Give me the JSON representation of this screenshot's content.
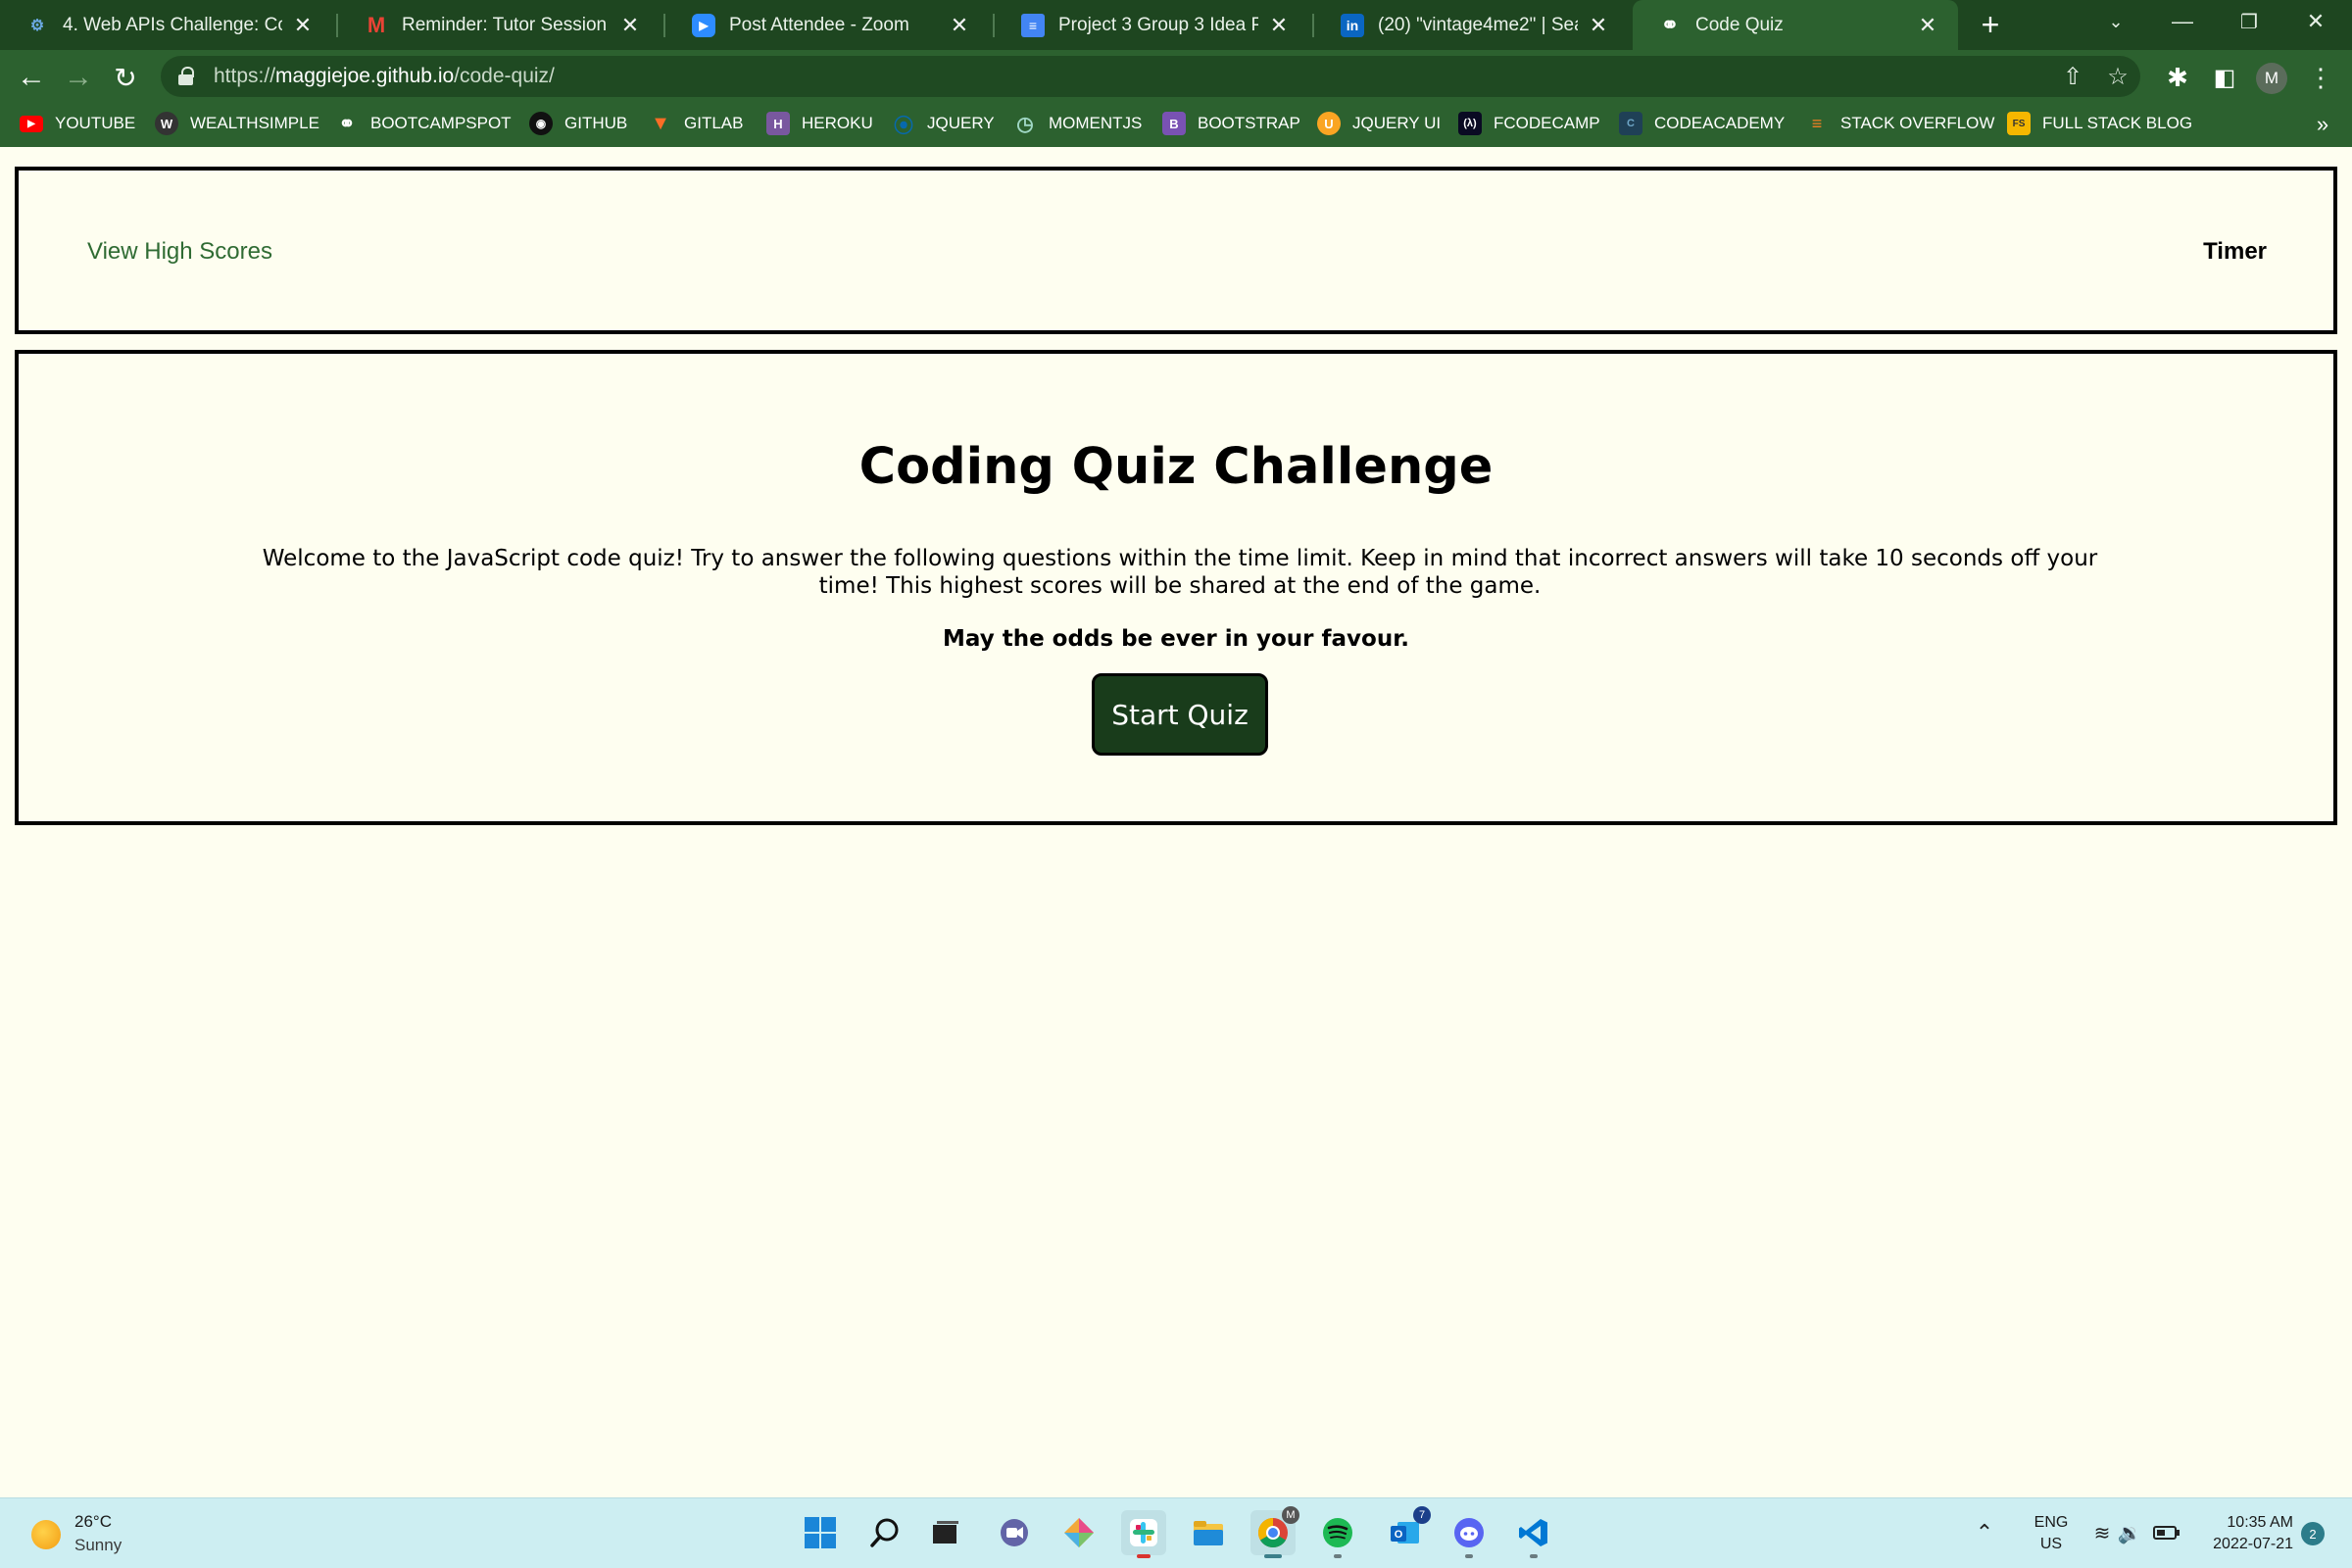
{
  "browser": {
    "tabs": [
      {
        "title": "4. Web APIs Challenge: Code",
        "icon": "bootcamp-icon"
      },
      {
        "title": "Reminder: Tutor Session with",
        "icon": "gmail-icon"
      },
      {
        "title": "Post Attendee - Zoom",
        "icon": "zoom-icon"
      },
      {
        "title": "Project 3 Group 3 Idea Propo",
        "icon": "docs-icon"
      },
      {
        "title": "(20) \"vintage4me2\" | Search |",
        "icon": "linkedin-icon"
      },
      {
        "title": "Code Quiz",
        "icon": "globe-icon",
        "active": true
      }
    ],
    "url_scheme": "https://",
    "url_host": "maggiejoe.github.io",
    "url_path": "/code-quiz/",
    "profile_initial": "M"
  },
  "bookmarks": [
    {
      "label": "YOUTUBE",
      "icon": "youtube-icon"
    },
    {
      "label": "WEALTHSIMPLE",
      "icon": "wealthsimple-icon"
    },
    {
      "label": "BOOTCAMPSPOT",
      "icon": "globe-icon"
    },
    {
      "label": "GITHUB",
      "icon": "github-icon"
    },
    {
      "label": "GITLAB",
      "icon": "gitlab-icon"
    },
    {
      "label": "HEROKU",
      "icon": "heroku-icon"
    },
    {
      "label": "JQUERY",
      "icon": "jquery-icon"
    },
    {
      "label": "MOMENTJS",
      "icon": "momentjs-icon"
    },
    {
      "label": "BOOTSTRAP",
      "icon": "bootstrap-icon"
    },
    {
      "label": "JQUERY UI",
      "icon": "jqueryui-icon"
    },
    {
      "label": "FCODECAMP",
      "icon": "freecodecamp-icon"
    },
    {
      "label": "CODEACADEMY",
      "icon": "codecademy-icon"
    },
    {
      "label": "STACK OVERFLOW",
      "icon": "stackoverflow-icon"
    },
    {
      "label": "FULL STACK BLOG",
      "icon": "fullstack-icon"
    }
  ],
  "page": {
    "high_scores_link": "View High Scores",
    "timer_label": "Timer",
    "quiz_title": "Coding Quiz Challenge",
    "quiz_description": "Welcome to the JavaScript code quiz! Try to answer the following questions within the time limit. Keep in mind that incorrect answers will take 10 seconds off your time! This highest scores will be shared at the end of the game.",
    "quiz_motto": "May the odds be ever in your favour.",
    "start_button": "Start Quiz"
  },
  "taskbar": {
    "weather_temp": "26°C",
    "weather_condition": "Sunny",
    "lang_line1": "ENG",
    "lang_line2": "US",
    "time": "10:35 AM",
    "date": "2022-07-21",
    "notification_count": "2",
    "outlook_badge": "7",
    "chrome_badge": "M"
  },
  "colors": {
    "chrome_dark": "#1e4620",
    "chrome": "#2c612f",
    "page_bg": "#fefef0",
    "link": "#2f6b33",
    "button_bg": "#193c1b",
    "taskbar_bg": "#cdeef2"
  }
}
